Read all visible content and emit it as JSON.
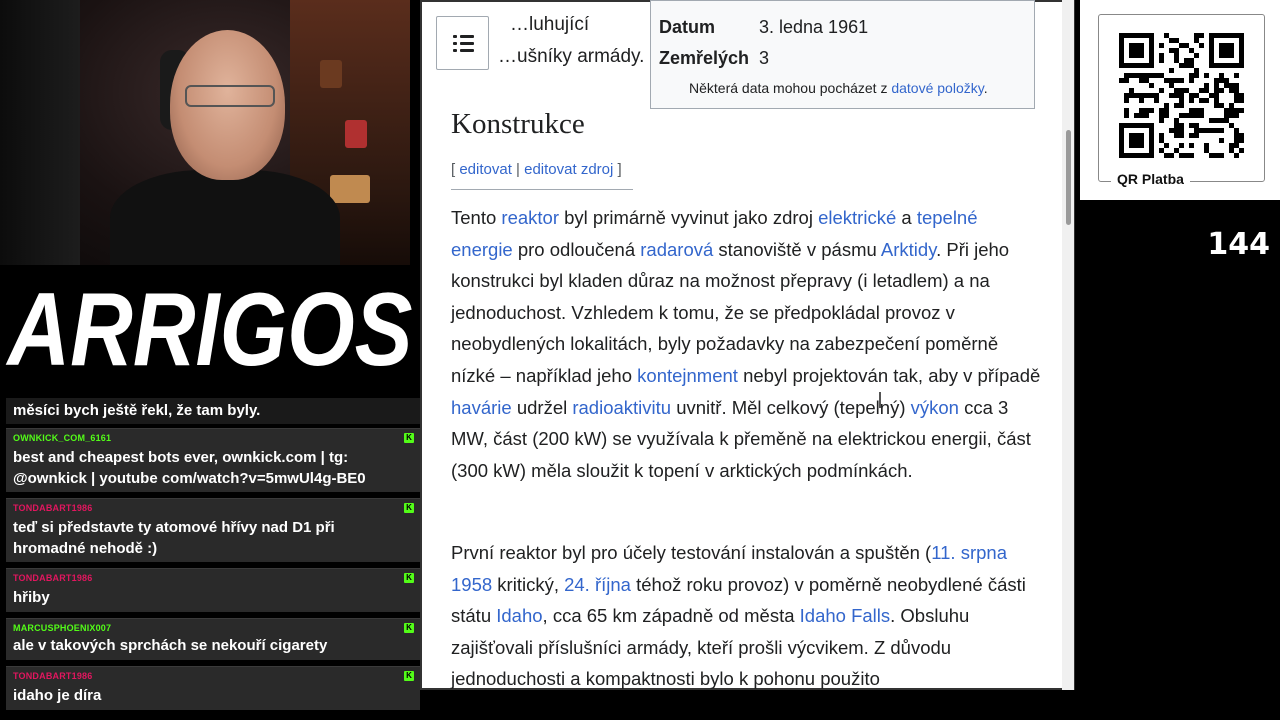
{
  "chat": {
    "messages": [
      {
        "user": "",
        "text": "měsíci bych ještě řekl, že tam byly.",
        "color": "#ffffff"
      },
      {
        "user": "OWNKICK_COM_6161",
        "text": "best and cheapest bots ever, ownkick.com | tg: @ownkick | youtube com/watch?v=5mwUl4g-BE0",
        "color": "#53fc18"
      },
      {
        "user": "TONDABART1986",
        "text": "teď si představte ty atomové hřívy nad D1 při hromadné nehodě :)",
        "color": "#e2165f"
      },
      {
        "user": "TONDABART1986",
        "text": "hřiby",
        "color": "#e2165f"
      },
      {
        "user": "MARCUSPHOENIX007",
        "text": "ale v takových sprchách se nekouří cigarety",
        "color": "#53fc18"
      },
      {
        "user": "TONDABART1986",
        "text": "idaho je díra",
        "color": "#e2165f"
      }
    ],
    "badge_icon": "kick-badge-icon"
  },
  "logo": {
    "text": "ARRIGOS"
  },
  "wiki": {
    "prev_line1": "…luhující",
    "prev_line2": "…ušníky armády.",
    "infobox": {
      "date_label": "Datum",
      "date_value": "3. ledna 1961",
      "deaths_label": "Zemřelých",
      "deaths_value": "3",
      "note_pre": "Některá data mohou pocházet z ",
      "note_link": "datové položky",
      "note_post": "."
    },
    "section_title": "Konstrukce",
    "edit_open": "[ ",
    "edit_link": "editovat",
    "edit_sep": " | ",
    "edit_source_link": "editovat zdroj",
    "edit_close": " ]",
    "p1": [
      {
        "t": "Tento "
      },
      {
        "t": "reaktor",
        "link": true
      },
      {
        "t": " byl primárně vyvinut jako zdroj "
      },
      {
        "t": "elektrické",
        "link": true
      },
      {
        "t": " a "
      },
      {
        "t": "tepelné energie",
        "link": true
      },
      {
        "t": " pro odloučená "
      },
      {
        "t": "radarová",
        "link": true
      },
      {
        "t": " stanoviště v pásmu "
      },
      {
        "t": "Arktidy",
        "link": true
      },
      {
        "t": ". Při jeho konstrukci byl kladen důraz na možnost přepravy (i letadlem) a na jednoduchost. Vzhledem k tomu, že se předpokládal provoz v neobydlených lokalitách, byly požadavky na zabezpečení poměrně nízké – například jeho "
      },
      {
        "t": "kontejnment",
        "link": true
      },
      {
        "t": " nebyl projektován tak, aby v případě "
      },
      {
        "t": "havárie",
        "link": true
      },
      {
        "t": " udržel "
      },
      {
        "t": "radioaktivitu",
        "link": true
      },
      {
        "t": " uvnitř. Měl celkový (tepelný) "
      },
      {
        "t": "výkon",
        "link": true
      },
      {
        "t": " cca 3 MW, část (200 kW) se využívala k přeměně na elektrickou energii, část (300 kW) měla sloužit k topení v arktických podmínkách."
      }
    ],
    "p2": [
      {
        "t": "První reaktor byl pro účely testování instalován a spuštěn ("
      },
      {
        "t": "11. srpna 1958",
        "link": true
      },
      {
        "t": " kritický, "
      },
      {
        "t": "24. října",
        "link": true
      },
      {
        "t": " téhož roku provoz) v poměrně neobydlené části státu "
      },
      {
        "t": "Idaho",
        "link": true
      },
      {
        "t": ", cca 65 km západně od města "
      },
      {
        "t": "Idaho Falls",
        "link": true
      },
      {
        "t": ". Obsluhu zajišťovali příslušníci armády, kteří prošli výcvikem. Z důvodu jednoduchosti a kompaktnosti bylo k pohonu použito"
      }
    ]
  },
  "qr": {
    "label": "QR Platba"
  },
  "viewers": "144",
  "colors": {
    "link": "#3366cc",
    "kick_green": "#53fc18",
    "mod_pink": "#e2165f"
  }
}
